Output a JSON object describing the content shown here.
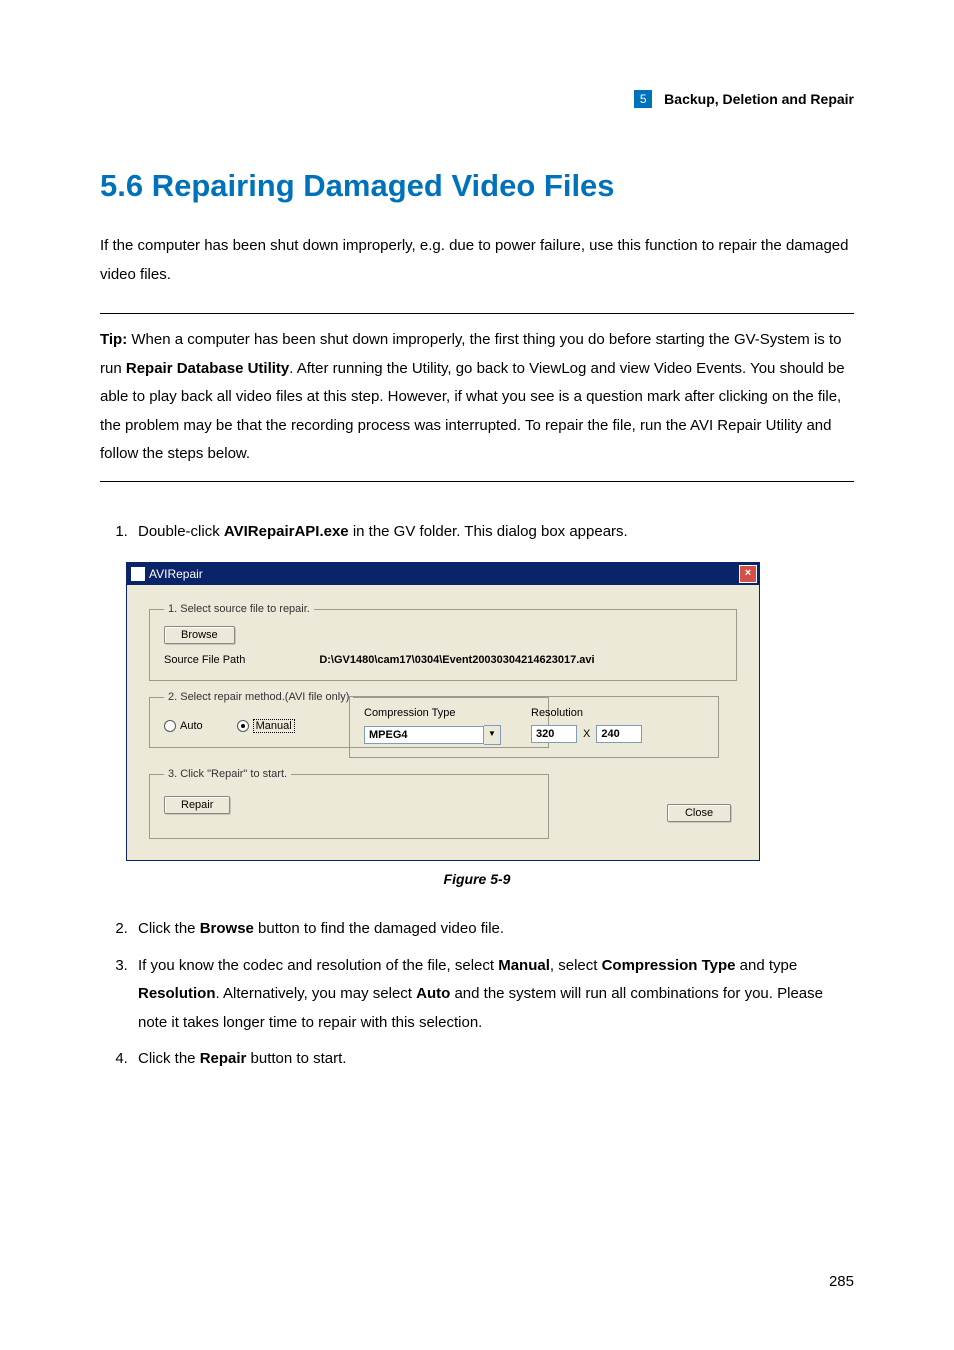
{
  "header": {
    "chapter_number": "5",
    "chapter_title": "Backup, Deletion and Repair"
  },
  "heading": "5.6   Repairing Damaged Video Files",
  "intro": "If the computer has been shut down improperly, e.g. due to power failure, use this function to repair the damaged video files.",
  "tip": {
    "label": "Tip:",
    "text": " When a computer has been shut down improperly, the first thing you do before starting the GV-System is to run ",
    "bold1": "Repair Database Utility",
    "text2": ". After running the Utility, go back to ViewLog and view Video Events. You should be able to play back all video files at this step. However, if what you see is a question mark after clicking on the file, the problem may be that the recording process was interrupted. To repair the file, run the AVI Repair Utility and follow the steps below."
  },
  "step1": {
    "pre": "Double-click ",
    "bold": "AVIRepairAPI.exe",
    "post": " in the GV folder. This dialog box appears."
  },
  "dialog": {
    "title": "AVIRepair",
    "close": "×",
    "group1": {
      "legend": "1. Select source file to repair.",
      "browse": "Browse",
      "label": "Source File Path",
      "path": "D:\\GV1480\\cam17\\0304\\Event20030304214623017.avi"
    },
    "group2": {
      "legend": "2. Select repair method.(AVI file only)",
      "auto": "Auto",
      "manual": "Manual",
      "comp_label": "Compression Type",
      "comp_value": "MPEG4",
      "res_label": "Resolution",
      "res_w": "320",
      "res_x": "X",
      "res_h": "240"
    },
    "group3": {
      "legend": "3. Click \"Repair\" to start.",
      "repair": "Repair",
      "close": "Close"
    }
  },
  "figure": "Figure 5-9",
  "step2": {
    "pre": "Click the ",
    "bold": "Browse",
    "post": " button to find the damaged video file."
  },
  "step3": {
    "t1": "If you know the codec and resolution of the file, select ",
    "b1": "Manual",
    "t2": ", select ",
    "b2": "Compression Type",
    "t3": " and type ",
    "b3": "Resolution",
    "t4": ". Alternatively, you may select ",
    "b4": "Auto",
    "t5": " and the system will run all combinations for you. Please note it takes longer time to repair with this selection."
  },
  "step4": {
    "pre": "Click the ",
    "bold": "Repair",
    "post": " button to start."
  },
  "page_number": "285"
}
